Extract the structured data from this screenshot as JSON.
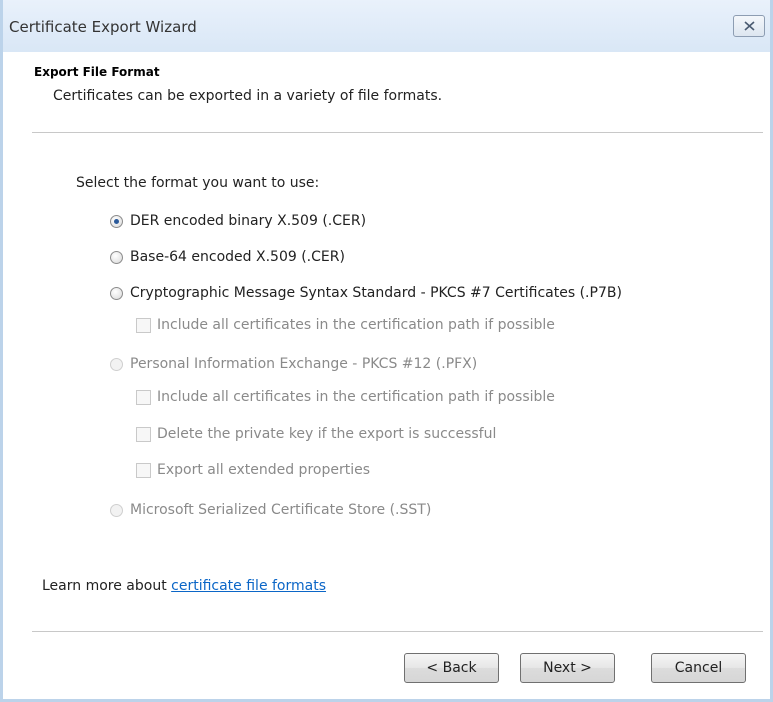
{
  "window": {
    "title": "Certificate Export Wizard"
  },
  "header": {
    "title": "Export File Format",
    "subtitle": "Certificates can be exported in a variety of file formats."
  },
  "main": {
    "prompt": "Select the format you want to use:",
    "options": [
      {
        "label": "DER encoded binary X.509 (.CER)",
        "type": "radio",
        "checked": true,
        "enabled": true
      },
      {
        "label": "Base-64 encoded X.509 (.CER)",
        "type": "radio",
        "checked": false,
        "enabled": true
      },
      {
        "label": "Cryptographic Message Syntax Standard - PKCS #7 Certificates (.P7B)",
        "type": "radio",
        "checked": false,
        "enabled": true
      },
      {
        "label": "Include all certificates in the certification path if possible",
        "type": "checkbox",
        "checked": false,
        "enabled": false
      },
      {
        "label": "Personal Information Exchange - PKCS #12 (.PFX)",
        "type": "radio",
        "checked": false,
        "enabled": false
      },
      {
        "label": "Include all certificates in the certification path if possible",
        "type": "checkbox",
        "checked": false,
        "enabled": false
      },
      {
        "label": "Delete the private key if the export is successful",
        "type": "checkbox",
        "checked": false,
        "enabled": false
      },
      {
        "label": "Export all extended properties",
        "type": "checkbox",
        "checked": false,
        "enabled": false
      },
      {
        "label": "Microsoft Serialized Certificate Store (.SST)",
        "type": "radio",
        "checked": false,
        "enabled": false
      }
    ],
    "learn_more_prefix": "Learn more about ",
    "learn_more_link": "certificate file formats"
  },
  "footer": {
    "back_label": "< Back",
    "next_label": "Next >",
    "cancel_label": "Cancel"
  },
  "icons": {
    "close": "close-icon"
  },
  "colors": {
    "titlebar": "#dbe8f6",
    "link": "#0b66c7",
    "radio_selected": "#2b5a9a",
    "disabled_text": "#8a8a8a"
  }
}
